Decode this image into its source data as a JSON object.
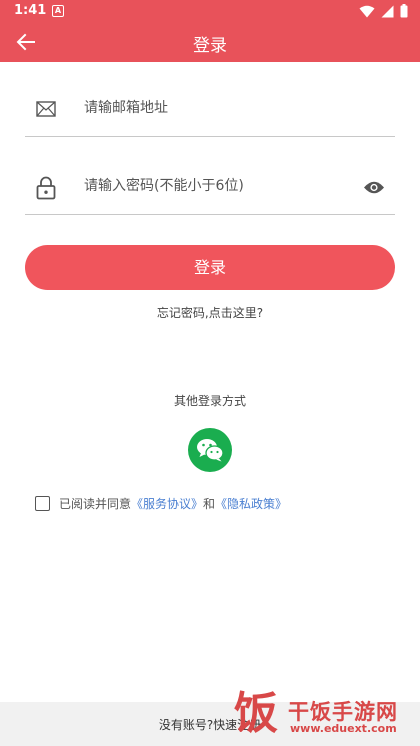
{
  "status_bar": {
    "time": "1:41",
    "notification_glyph": "A"
  },
  "app_bar": {
    "title": "登录"
  },
  "email_field": {
    "placeholder": "请输邮箱地址"
  },
  "password_field": {
    "placeholder": "请输入密码(不能小于6位)"
  },
  "login_button": {
    "label": "登录"
  },
  "forgot_password": {
    "label": "忘记密码,点击这里?"
  },
  "other_login": {
    "label": "其他登录方式"
  },
  "agreement": {
    "prefix": "已阅读并同意",
    "terms": "《服务协议》",
    "and": "和",
    "privacy": "《隐私政策》"
  },
  "footer": {
    "register_prompt": "没有账号?快速注册"
  },
  "watermark": {
    "glyph": "饭",
    "name": "干饭手游网",
    "url": "www.eduext.com"
  },
  "colors": {
    "accent": "#e8525a",
    "button": "#f0555c",
    "wechat": "#1aad4f",
    "link": "#4a7fd1"
  },
  "icons": {
    "back": "arrow-left-icon",
    "email": "mail-icon",
    "password": "lock-icon",
    "visibility": "eye-icon",
    "wechat": "wechat-icon"
  }
}
